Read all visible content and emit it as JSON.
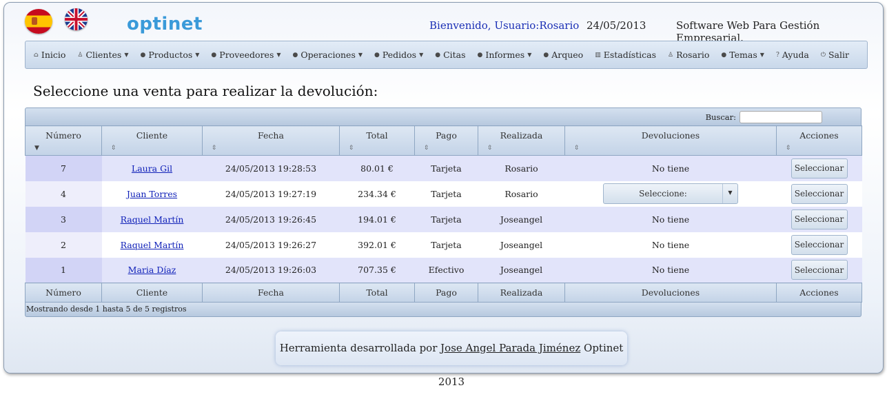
{
  "header": {
    "logo": "optinet",
    "welcome": "Bienvenido, Usuario:Rosario",
    "date": "24/05/2013",
    "tagline": "Software Web Para Gestión Empresarial."
  },
  "menu": [
    {
      "label": "Inicio",
      "icon": "home-icon",
      "dropdown": false
    },
    {
      "label": "Clientes",
      "icon": "user-icon",
      "dropdown": true
    },
    {
      "label": "Productos",
      "icon": "bullet-icon",
      "dropdown": true
    },
    {
      "label": "Proveedores",
      "icon": "bullet-icon",
      "dropdown": true
    },
    {
      "label": "Operaciones",
      "icon": "bullet-icon",
      "dropdown": true
    },
    {
      "label": "Pedidos",
      "icon": "bullet-icon",
      "dropdown": true
    },
    {
      "label": "Citas",
      "icon": "bullet-icon",
      "dropdown": false
    },
    {
      "label": "Informes",
      "icon": "bullet-icon",
      "dropdown": true
    },
    {
      "label": "Arqueo",
      "icon": "bullet-icon",
      "dropdown": false
    },
    {
      "label": "Estadísticas",
      "icon": "chart-icon",
      "dropdown": false
    },
    {
      "label": "Rosario",
      "icon": "user-icon",
      "dropdown": false
    },
    {
      "label": "Temas",
      "icon": "bullet-icon",
      "dropdown": true
    },
    {
      "label": "Ayuda",
      "icon": "help-icon",
      "dropdown": false
    },
    {
      "label": "Salir",
      "icon": "power-icon",
      "dropdown": false
    }
  ],
  "page": {
    "heading": "Seleccione una venta para realizar la devolución:"
  },
  "table": {
    "search_label": "Buscar:",
    "search_value": "",
    "columns": [
      "Número",
      "Cliente",
      "Fecha",
      "Total",
      "Pago",
      "Realizada",
      "Devoluciones",
      "Acciones"
    ],
    "rows": [
      {
        "numero": "7",
        "cliente": "Laura Gil",
        "fecha": "24/05/2013 19:28:53",
        "total": "80.01 €",
        "pago": "Tarjeta",
        "realizada": "Rosario",
        "devoluciones": "No tiene",
        "accion": "Seleccionar"
      },
      {
        "numero": "4",
        "cliente": "Juan Torres",
        "fecha": "24/05/2013 19:27:19",
        "total": "234.34 €",
        "pago": "Tarjeta",
        "realizada": "Rosario",
        "devoluciones": "Seleccione:",
        "accion": "Seleccionar"
      },
      {
        "numero": "3",
        "cliente": "Raquel Martín",
        "fecha": "24/05/2013 19:26:45",
        "total": "194.01 €",
        "pago": "Tarjeta",
        "realizada": "Joseangel",
        "devoluciones": "No tiene",
        "accion": "Seleccionar"
      },
      {
        "numero": "2",
        "cliente": "Raquel Martín",
        "fecha": "24/05/2013 19:26:27",
        "total": "392.01 €",
        "pago": "Tarjeta",
        "realizada": "Joseangel",
        "devoluciones": "No tiene",
        "accion": "Seleccionar"
      },
      {
        "numero": "1",
        "cliente": "Maria Díaz",
        "fecha": "24/05/2013 19:26:03",
        "total": "707.35 €",
        "pago": "Efectivo",
        "realizada": "Joseangel",
        "devoluciones": "No tiene",
        "accion": "Seleccionar"
      }
    ],
    "info": "Mostrando desde 1 hasta 5 de 5 registros"
  },
  "footer": {
    "prefix": "Herramienta desarrollada por",
    "author": "Jose Angel Parada Jiménez",
    "suffix": "Optinet 2013"
  },
  "colors": {
    "accent": "#3a9ad9",
    "link": "#1021b8",
    "welcome": "#1a2fb5"
  }
}
